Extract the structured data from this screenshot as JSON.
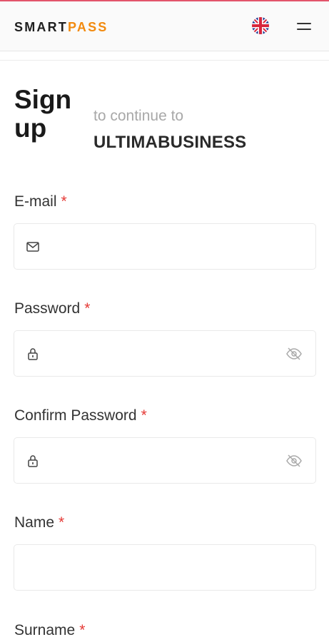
{
  "header": {
    "logo_part1": "SMART",
    "logo_part2": "PASS",
    "accent_color": "#f28a0f",
    "top_line_color": "#e2546b",
    "language_icon": "uk-flag-icon",
    "menu_icon": "hamburger-menu-icon"
  },
  "heading": {
    "title": "Sign up",
    "subtitle": "to continue to",
    "app_name": "ULTIMABUSINESS"
  },
  "form": {
    "required_marker": "*",
    "required_color": "#e53935",
    "email": {
      "label": "E-mail",
      "value": "",
      "icon": "envelope-icon"
    },
    "password": {
      "label": "Password",
      "value": "",
      "icon": "lock-icon",
      "toggle_icon": "eye-off-icon"
    },
    "confirm_password": {
      "label": "Confirm Password",
      "value": "",
      "icon": "lock-icon",
      "toggle_icon": "eye-off-icon"
    },
    "name": {
      "label": "Name",
      "value": ""
    },
    "surname": {
      "label": "Surname"
    }
  }
}
